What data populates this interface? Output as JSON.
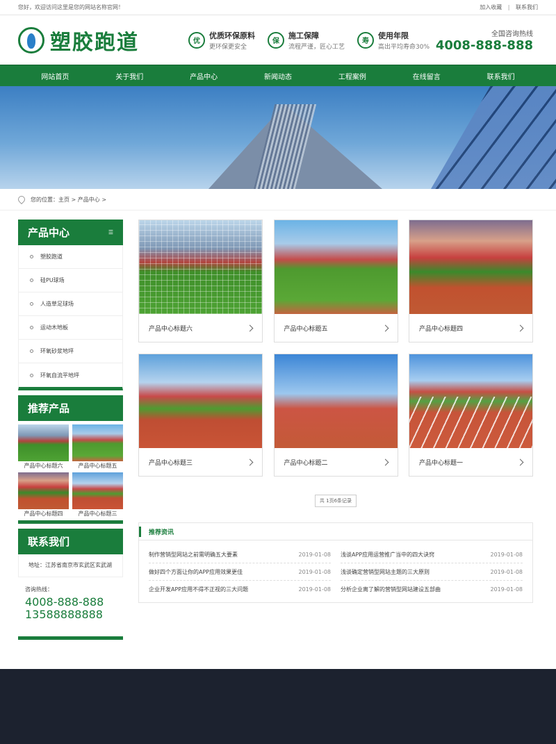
{
  "topbar": {
    "welcome": "您好，欢迎访问这里是您的网站名称官网！",
    "add_fav": "加入收藏",
    "sep": "|",
    "contact": "联系我们"
  },
  "header": {
    "logo_text": "塑胶跑道",
    "features": [
      {
        "badge": "优",
        "title": "优质环保原料",
        "sub": "更环保更安全"
      },
      {
        "badge": "保",
        "title": "施工保障",
        "sub": "流程严谨，匠心工艺"
      },
      {
        "badge": "寿",
        "title": "使用年限",
        "sub": "高出平均寿命30%"
      }
    ],
    "hotline_label": "全国咨询热线",
    "hotline_num": "4008-888-888"
  },
  "nav": [
    "网站首页",
    "关于我们",
    "产品中心",
    "新闻动态",
    "工程案例",
    "在线留言",
    "联系我们"
  ],
  "breadcrumb": "您的位置：主页 > 产品中心 >",
  "sidebar": {
    "products_title": "产品中心",
    "products": [
      "塑胶跑道",
      "硅PU球场",
      "人造草足球场",
      "运动木地板",
      "环氧砂浆地坪",
      "环氧自流平地坪"
    ],
    "rec_title": "推荐产品",
    "rec": [
      "产品中心标题六",
      "产品中心标题五",
      "产品中心标题四",
      "产品中心标题三"
    ],
    "contact_title": "联系我们",
    "address": "地址：江苏省南京市玄武区玄武湖",
    "tel_label": "咨询热线：",
    "tel1": "4008-888-888",
    "tel2": "13588888888"
  },
  "products": [
    {
      "title": "产品中心标题六"
    },
    {
      "title": "产品中心标题五"
    },
    {
      "title": "产品中心标题四"
    },
    {
      "title": "产品中心标题三"
    },
    {
      "title": "产品中心标题二"
    },
    {
      "title": "产品中心标题一"
    }
  ],
  "pager": "共 1页6条记录",
  "news": {
    "title": "推荐资讯",
    "left": [
      {
        "title": "制作营销型网站之前需明确五大要素",
        "date": "2019-01-08"
      },
      {
        "title": "做好四个方面让你的APP应用效果更佳",
        "date": "2019-01-08"
      },
      {
        "title": "企业开发APP应用不得不正视的三大问题",
        "date": "2019-01-08"
      }
    ],
    "right": [
      {
        "title": "浅谈APP应用运营推广当中的四大诀窍",
        "date": "2019-01-08"
      },
      {
        "title": "浅谈确定营销型网站主题的三大原则",
        "date": "2019-01-08"
      },
      {
        "title": "分析企业离了解的营销型网站建设五部曲",
        "date": "2019-01-08"
      }
    ]
  },
  "colors": {
    "brand": "#1a7d3c",
    "footer": "#1c222f"
  }
}
